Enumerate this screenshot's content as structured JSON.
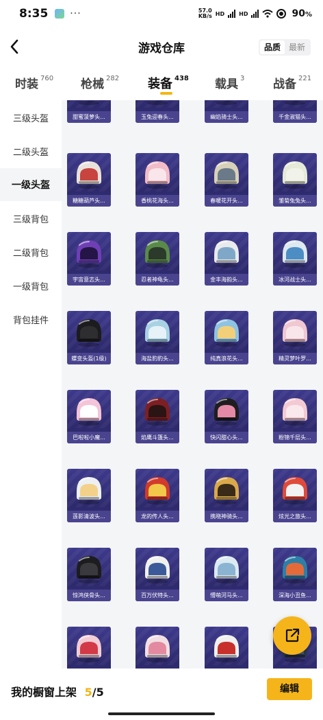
{
  "status_bar": {
    "time": "8:35",
    "dots": "···",
    "net_speed_top": "57.0",
    "net_speed_unit": "KB/s",
    "signal_label_1": "HD",
    "signal_label_2": "HD",
    "battery": "90"
  },
  "header": {
    "title": "游戏仓库",
    "sort_options": [
      "品质",
      "最新"
    ],
    "sort_selected": "品质"
  },
  "tabs": [
    {
      "label": "时装",
      "count": "760"
    },
    {
      "label": "枪械",
      "count": "282"
    },
    {
      "label": "装备",
      "count": "438",
      "active": true
    },
    {
      "label": "载具",
      "count": "3"
    },
    {
      "label": "战备",
      "count": "221"
    }
  ],
  "sidebar": {
    "items": [
      {
        "label": "三级头盔"
      },
      {
        "label": "二级头盔"
      },
      {
        "label": "一级头盔",
        "active": true
      },
      {
        "label": "三级背包"
      },
      {
        "label": "二级背包"
      },
      {
        "label": "一级背包"
      },
      {
        "label": "背包挂件"
      }
    ]
  },
  "items": [
    {
      "name": "甜蜜菠萝头...",
      "color": "#f2c9d3",
      "visor": "#1a1a1a"
    },
    {
      "name": "玉兔迎春头...",
      "color": "#e6e2de",
      "visor": "#e07585"
    },
    {
      "name": "幽焰骑士头...",
      "color": "#2a2a2a",
      "visor": "#4a4a4a"
    },
    {
      "name": "千金淑猫头...",
      "color": "#f3d0da",
      "visor": "#f6e6ea"
    },
    {
      "name": "糖糖葫芦头...",
      "color": "#e9e2dc",
      "visor": "#c8443f"
    },
    {
      "name": "香桃花海头...",
      "color": "#f2bcc8",
      "visor": "#f8e6ea"
    },
    {
      "name": "春暖花开头...",
      "color": "#d8d0b9",
      "visor": "#6a7a88"
    },
    {
      "name": "雏菊兔兔头...",
      "color": "#e5ead8",
      "visor": "#f1f2ea"
    },
    {
      "name": "宇宙意志头...",
      "color": "#6f3fb6",
      "visor": "#251546"
    },
    {
      "name": "忍者神龟头...",
      "color": "#5a8a4a",
      "visor": "#2b3a2a"
    },
    {
      "name": "金丰海韵头...",
      "color": "#e8eaec",
      "visor": "#7fa8c8"
    },
    {
      "name": "冰河战士头...",
      "color": "#dde8ef",
      "visor": "#4c8dc4"
    },
    {
      "name": "蝶变头盔(1级)",
      "color": "#1c1c1e",
      "visor": "#2e2e30"
    },
    {
      "name": "海盐豹豹头...",
      "color": "#a8d2e4",
      "visor": "#e6f2f7"
    },
    {
      "name": "纯真浪花头...",
      "color": "#8fc3e3",
      "visor": "#f2d07a"
    },
    {
      "name": "精灵梦叶罗...",
      "color": "#f0c8d2",
      "visor": "#f8e6eb"
    },
    {
      "name": "巴啦啦小魔...",
      "color": "#f4c4d8",
      "visor": "#ffffff"
    },
    {
      "name": "焰鹰斗篷头...",
      "color": "#7d1f22",
      "visor": "#2a1414"
    },
    {
      "name": "快闪甜心头...",
      "color": "#1e1e20",
      "visor": "#e58aa6"
    },
    {
      "name": "粉锦千层头...",
      "color": "#f3cad3",
      "visor": "#f9e8ec"
    },
    {
      "name": "莲影清波头...",
      "color": "#ecf0f2",
      "visor": "#f4d18a"
    },
    {
      "name": "龙的传人头...",
      "color": "#d23a2b",
      "visor": "#f2c84a"
    },
    {
      "name": "携晓神骑头...",
      "color": "#d9a94a",
      "visor": "#3a2a18"
    },
    {
      "name": "炫光之旅头...",
      "color": "#e04a3a",
      "visor": "#f2f2f2"
    },
    {
      "name": "惊鸿侠骨头...",
      "color": "#1d1d1f",
      "visor": "#3a3a3e"
    },
    {
      "name": "百万伏特头...",
      "color": "#f0f0ee",
      "visor": "#3c5a9a"
    },
    {
      "name": "懵萌河马头...",
      "color": "#dceaf2",
      "visor": "#8ab4d2"
    },
    {
      "name": "深海小丑鱼...",
      "color": "#2e7fa6",
      "visor": "#e46a3a"
    },
    {
      "name": "",
      "color": "#f2cdd5",
      "visor": "#d33a48"
    },
    {
      "name": "",
      "color": "#f2dfe3",
      "visor": "#e48aa0"
    },
    {
      "name": "",
      "color": "#f0f0ee",
      "visor": "#c8302c"
    },
    {
      "name": "",
      "color": "#2c3a55",
      "visor": "#4a5a78"
    }
  ],
  "bottom_bar": {
    "label": "我的橱窗上架",
    "count_current": "5",
    "count_total": "/5",
    "edit_label": "编辑"
  },
  "icons": {
    "back": "chevron-left-icon",
    "share": "share-external-icon"
  }
}
